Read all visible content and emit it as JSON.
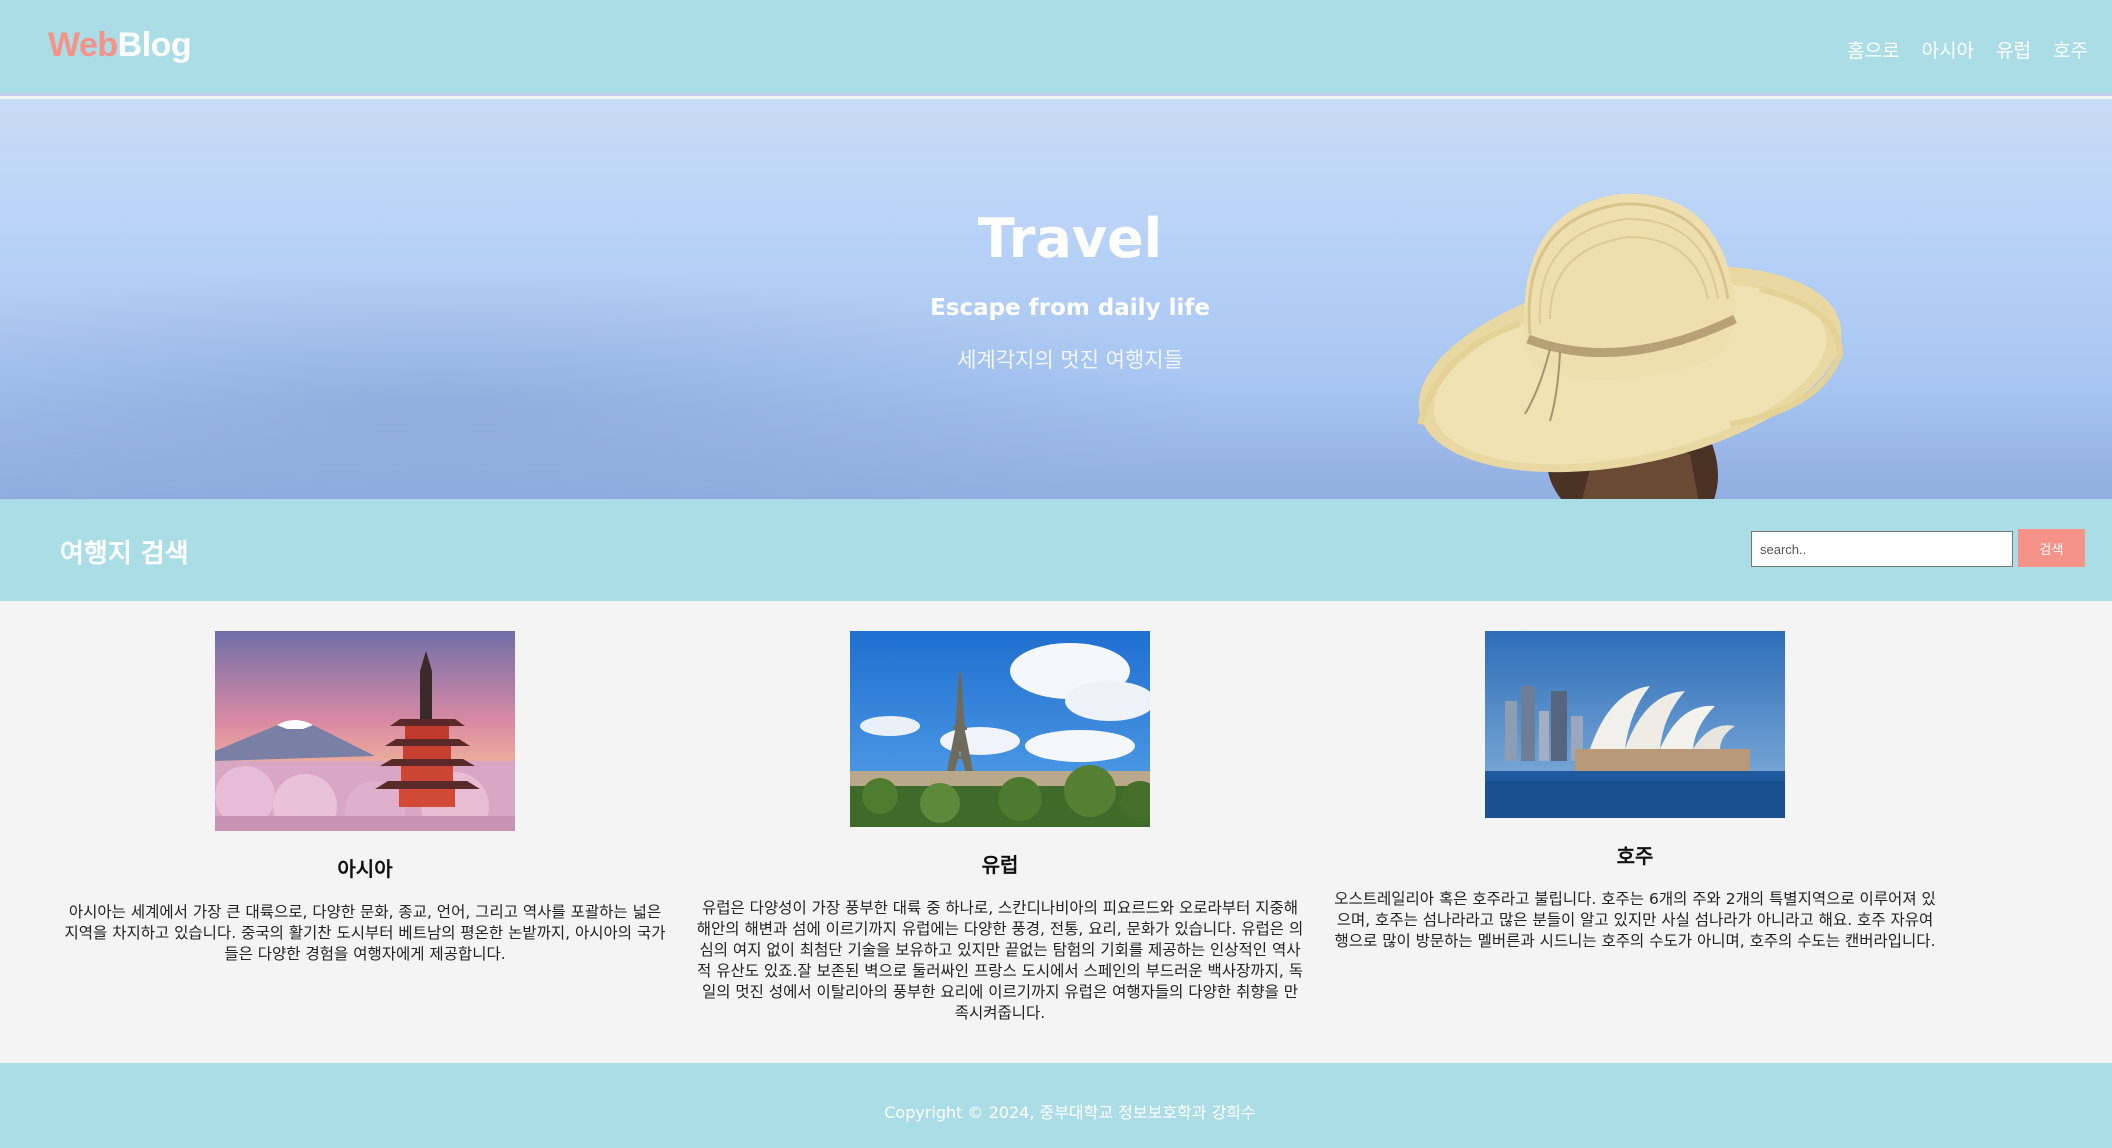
{
  "header": {
    "logo_part1": "Web",
    "logo_part2": "Blog",
    "nav": [
      "홈으로",
      "아시아",
      "유럽",
      "호주"
    ]
  },
  "hero": {
    "title": "Travel",
    "subtitle": "Escape from daily life",
    "tagline": "세계각지의 멋진 여행지들"
  },
  "search": {
    "title": "여행지 검색",
    "placeholder": "search..",
    "button_label": "검색"
  },
  "cards": [
    {
      "title": "아시아",
      "text": "아시아는 세계에서 가장 큰 대륙으로, 다양한 문화, 종교, 언어, 그리고 역사를 포괄하는 넓은 지역을 차지하고 있습니다. 중국의 활기찬 도시부터 베트남의 평온한 논밭까지, 아시아의 국가들은 다양한 경험을 여행자에게 제공합니다."
    },
    {
      "title": "유럽",
      "text": "유럽은 다양성이 가장 풍부한 대륙 중 하나로, 스칸디나비아의 피요르드와 오로라부터 지중해 해안의 해변과 섬에 이르기까지 유럽에는 다양한 풍경, 전통, 요리, 문화가 있습니다. 유럽은 의심의 여지 없이 최첨단 기술을 보유하고 있지만 끝없는 탐험의 기회를 제공하는 인상적인 역사적 유산도 있죠.잘 보존된 벽으로 둘러싸인 프랑스 도시에서 스페인의 부드러운 백사장까지, 독일의 멋진 성에서 이탈리아의 풍부한 요리에 이르기까지 유럽은 여행자들의 다양한 취향을 만족시켜줍니다."
    },
    {
      "title": "호주",
      "text": "오스트레일리아 혹은 호주라고 불립니다. 호주는 6개의 주와 2개의 특별지역으로 이루어져 있으며, 호주는 섬나라라고 많은 분들이 알고 있지만 사실 섬나라가 아니라고 해요. 호주 자유여행으로 많이 방문하는 멜버른과 시드니는 호주의 수도가 아니며, 호주의 수도는 캔버라입니다."
    }
  ],
  "footer": {
    "copyright": "Copyright © 2024, 중부대학교 정보보호학과 강희수"
  },
  "colors": {
    "header_bg": "#abdde6",
    "accent": "#f59389",
    "page_bg": "#f4f4f4"
  }
}
